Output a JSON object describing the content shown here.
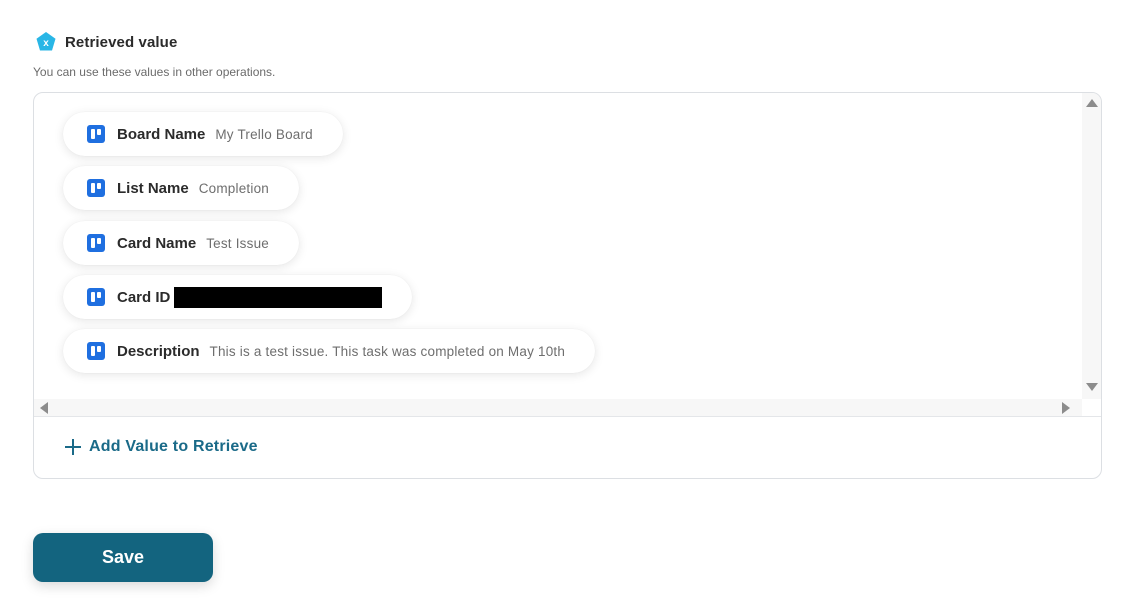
{
  "header": {
    "title": "Retrieved value",
    "badge_letter": "x",
    "subtitle": "You can use these values in other operations."
  },
  "values": [
    {
      "label": "Board Name",
      "value": "My Trello Board",
      "icon": "trello-icon"
    },
    {
      "label": "List Name",
      "value": "Completion",
      "icon": "trello-icon"
    },
    {
      "label": "Card Name",
      "value": "Test Issue",
      "icon": "trello-icon"
    },
    {
      "label": "Card ID",
      "value": "",
      "redacted": true,
      "icon": "trello-icon"
    },
    {
      "label": "Description",
      "value": "This is a test issue. This task was completed on May 10th",
      "icon": "trello-icon"
    }
  ],
  "add_value": {
    "label": "Add Value to Retrieve",
    "icon": "plus-icon"
  },
  "save_button": {
    "label": "Save"
  },
  "colors": {
    "accent": "#13647f",
    "link": "#1a6a88",
    "trello_blue": "#1f6fe0",
    "badge": "#29b6e6"
  }
}
